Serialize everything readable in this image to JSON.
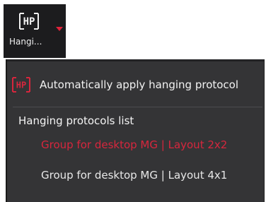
{
  "toolbar": {
    "button_label": "Hangi...",
    "logo_text": "HP",
    "icon": "hp-logo-icon",
    "dropdown_icon": "caret-down-icon"
  },
  "menu": {
    "auto_apply_label": "Automatically apply hanging protocol",
    "auto_apply_icon": "hp-logo-icon",
    "list_title": "Hanging protocols list",
    "protocols": [
      {
        "label": "Group for desktop MG | Layout 2x2",
        "selected": true
      },
      {
        "label": "Group for desktop MG | Layout 4x1",
        "selected": false
      }
    ]
  },
  "colors": {
    "accent": "#d7263d",
    "menu_bg": "#343436",
    "toolbar_bg": "#1c1c1e",
    "text": "#f2f2f2"
  }
}
